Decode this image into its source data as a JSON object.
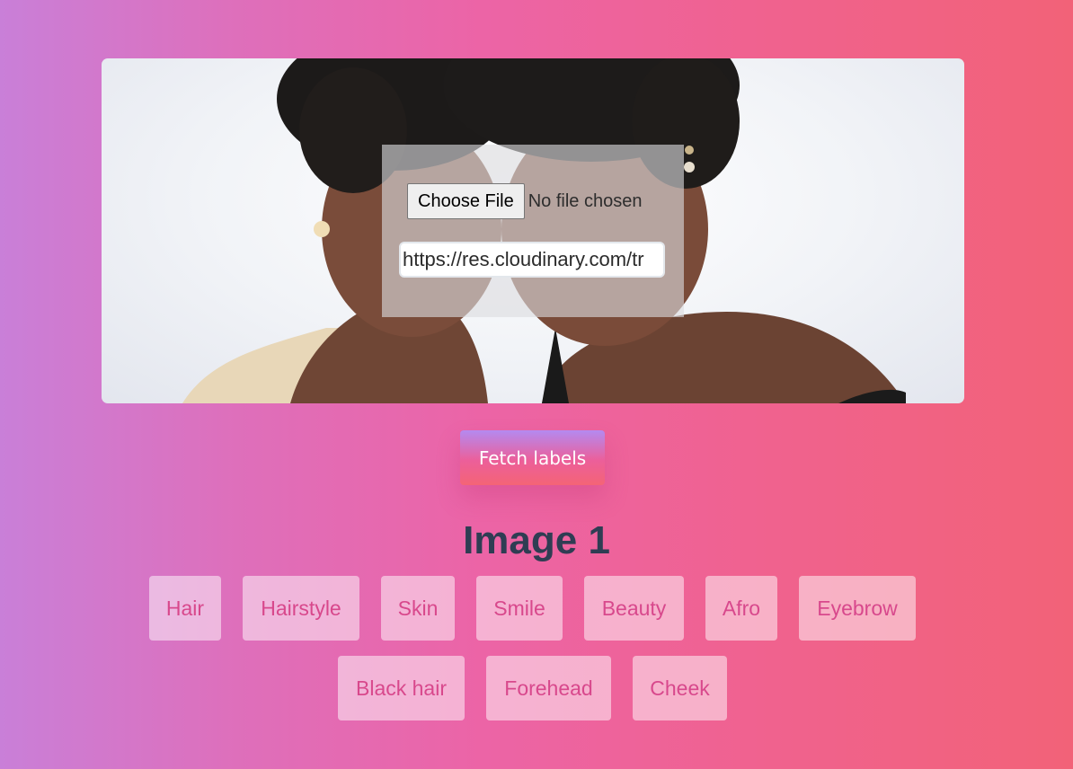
{
  "upload": {
    "choose_file_label": "Choose File",
    "file_status": "No file chosen",
    "url_value": "https://res.cloudinary.com/tr"
  },
  "actions": {
    "fetch_label": "Fetch labels"
  },
  "results": {
    "heading": "Image 1",
    "labels": [
      "Hair",
      "Hairstyle",
      "Skin",
      "Smile",
      "Beauty",
      "Afro",
      "Eyebrow",
      "Black hair",
      "Forehead",
      "Cheek"
    ]
  },
  "colors": {
    "heading": "#2f3d53",
    "chip_text": "#d8488c",
    "background_left": "#c97fd8",
    "background_right": "#f26278"
  }
}
